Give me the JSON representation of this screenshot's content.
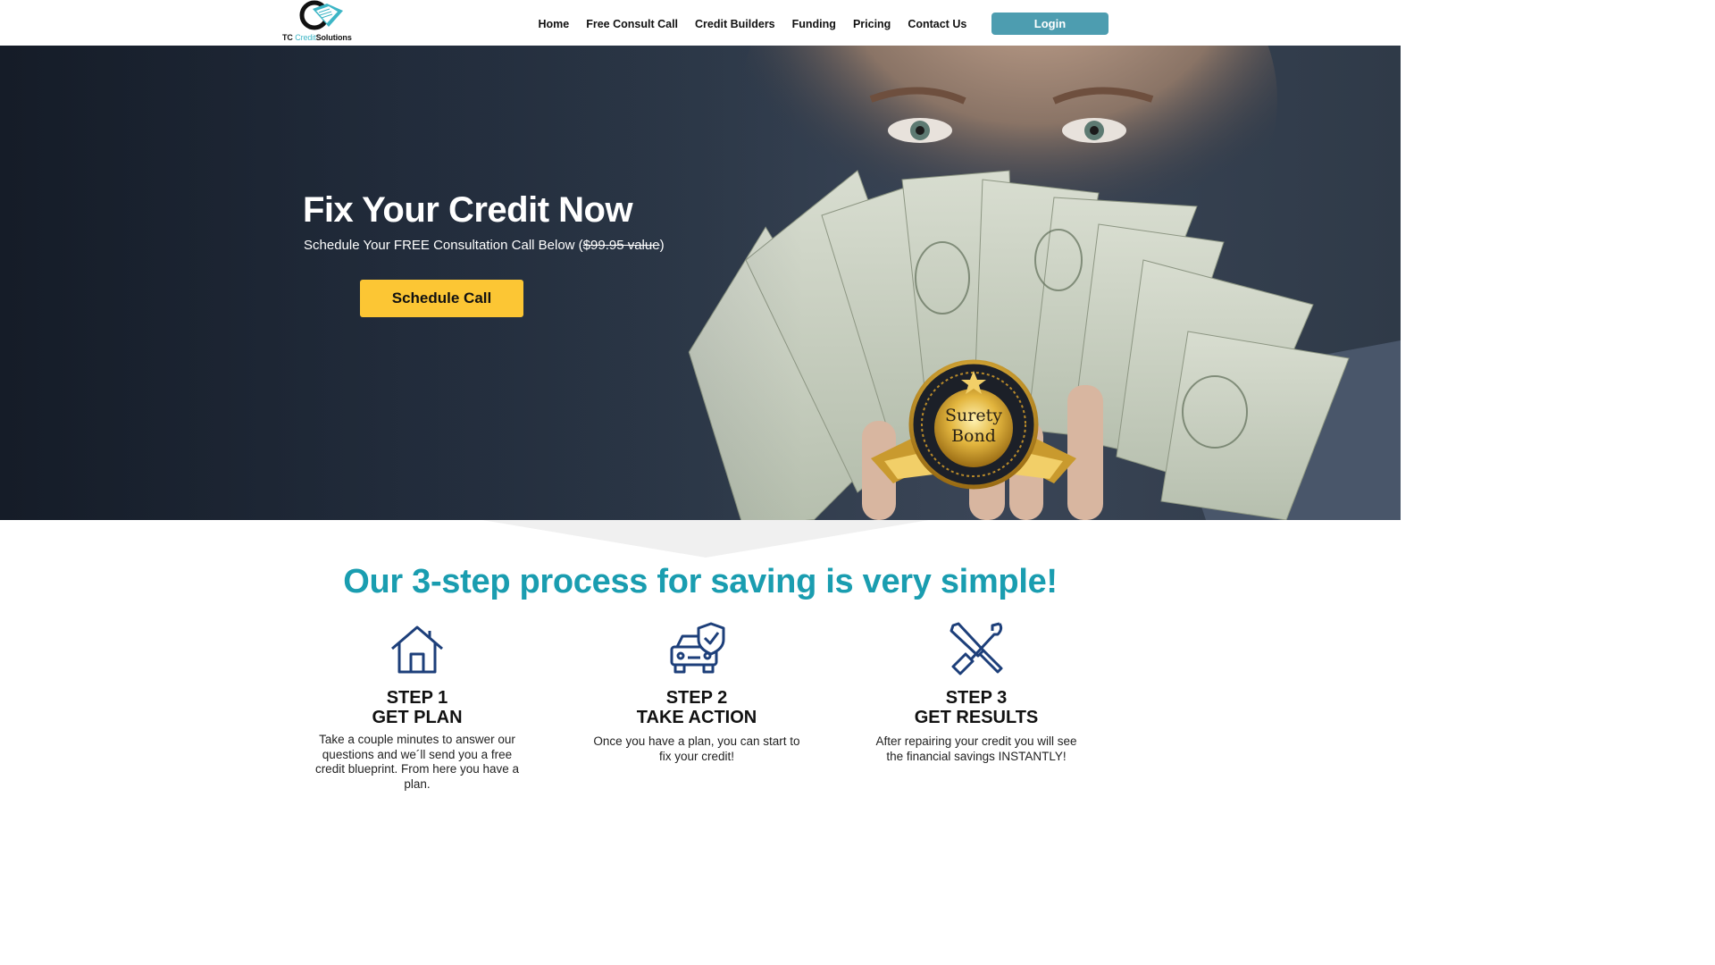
{
  "brand": {
    "logo_prefix": "TC ",
    "logo_accent": "Credit",
    "logo_suffix": "Solutions"
  },
  "nav": {
    "items": [
      "Home",
      "Free Consult Call",
      "Credit Builders",
      "Funding",
      "Pricing",
      "Contact Us"
    ],
    "login_label": "Login"
  },
  "hero": {
    "title": "Fix Your Credit Now",
    "subtitle_prefix": "Schedule Your FREE Consultation Call Below (",
    "subtitle_strike": "$99.95 value",
    "subtitle_suffix": ")",
    "cta_label": "Schedule Call",
    "badge_line1": "Surety",
    "badge_line2": "Bond"
  },
  "process": {
    "title": "Our 3-step process for saving is very simple!",
    "steps": [
      {
        "icon": "house-icon",
        "step": "STEP 1",
        "name": "GET PLAN",
        "desc": "Take a couple minutes to answer our questions and we´ll send you a free credit blueprint. From here you have a plan."
      },
      {
        "icon": "car-shield-icon",
        "step": "STEP 2",
        "name": "TAKE ACTION",
        "desc": "Once you have a plan, you can start to fix your credit!"
      },
      {
        "icon": "tools-icon",
        "step": "STEP 3",
        "name": "GET RESULTS",
        "desc": "After repairing your credit you will see the financial savings INSTANTLY!"
      }
    ]
  },
  "colors": {
    "accent": "#1a9db0",
    "cta": "#fcc634",
    "login": "#4d9db0",
    "icon": "#1d3f7a"
  }
}
